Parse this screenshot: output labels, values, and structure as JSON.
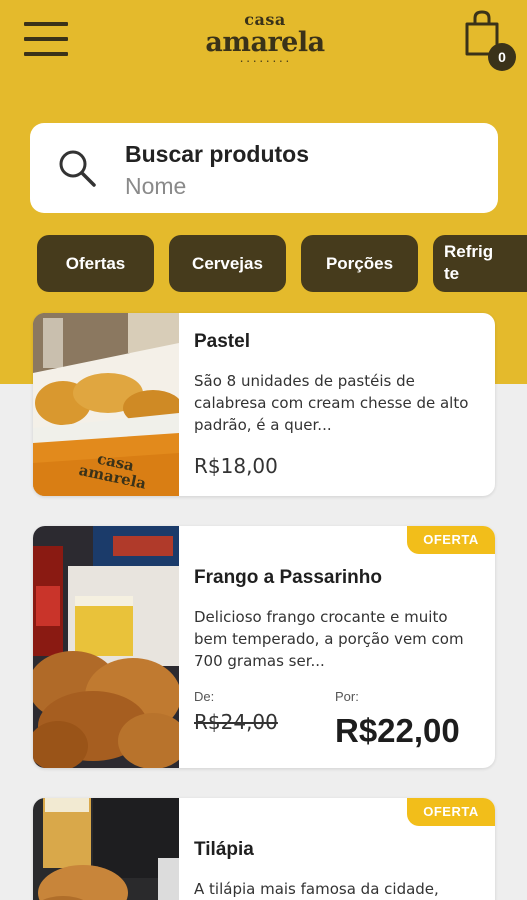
{
  "header": {
    "menu_icon": "hamburger-menu-icon",
    "logo_top": "casa",
    "logo_main": "amarela",
    "logo_dots": "• • • • • • • •",
    "cart_icon": "shopping-bag-icon",
    "cart_count": "0"
  },
  "search": {
    "title": "Buscar produtos",
    "placeholder": "Nome",
    "icon": "search-icon"
  },
  "categories": [
    {
      "label": "Ofertas"
    },
    {
      "label": "Cervejas"
    },
    {
      "label": "Porções"
    },
    {
      "label": "Refrig\nte"
    }
  ],
  "products": [
    {
      "name": "Pastel",
      "description": "São 8 unidades de pastéis de calabresa com cream chesse de alto padrão, é a quer...",
      "price": "R$18,00",
      "image_text": "casa amarela"
    },
    {
      "name": "Frango a Passarinho",
      "badge": "OFERTA",
      "description": "Delicioso frango crocante e muito bem temperado, a porção vem com 700 gramas ser...",
      "price_from_label": "De:",
      "price_from": "R$24,00",
      "price_to_label": "Por:",
      "price_to": "R$22,00"
    },
    {
      "name": "Tilápia",
      "badge": "OFERTA",
      "description": "A tilápia mais famosa da cidade,"
    }
  ],
  "colors": {
    "brand_yellow": "#e4ba2c",
    "dark_brown": "#463b1c",
    "badge_yellow": "#f2be1a"
  }
}
